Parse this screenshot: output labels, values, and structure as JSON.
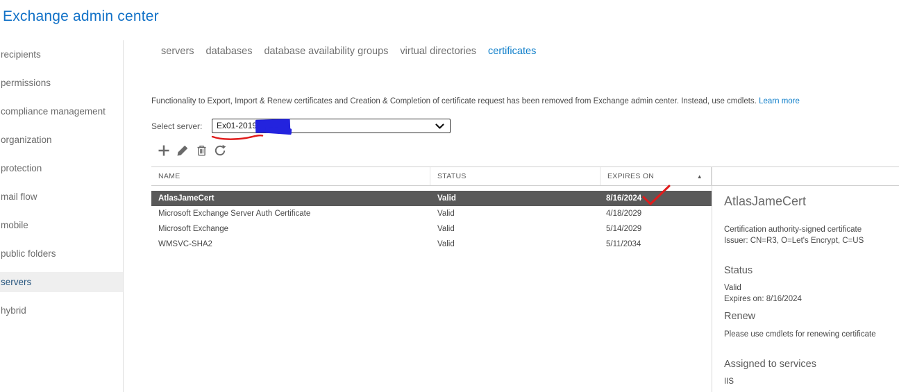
{
  "app": {
    "title": "Exchange admin center"
  },
  "sidebar": {
    "items": [
      {
        "label": "recipients",
        "selected": false
      },
      {
        "label": "permissions",
        "selected": false
      },
      {
        "label": "compliance management",
        "selected": false
      },
      {
        "label": "organization",
        "selected": false
      },
      {
        "label": "protection",
        "selected": false
      },
      {
        "label": "mail flow",
        "selected": false
      },
      {
        "label": "mobile",
        "selected": false
      },
      {
        "label": "public folders",
        "selected": false
      },
      {
        "label": "servers",
        "selected": true
      },
      {
        "label": "hybrid",
        "selected": false
      }
    ]
  },
  "tabs": [
    {
      "label": "servers",
      "selected": false
    },
    {
      "label": "databases",
      "selected": false
    },
    {
      "label": "database availability groups",
      "selected": false
    },
    {
      "label": "virtual directories",
      "selected": false
    },
    {
      "label": "certificates",
      "selected": true
    }
  ],
  "notice": {
    "text": "Functionality to Export, Import & Renew certificates and Creation & Completion of certificate request has been removed from Exchange admin center. Instead, use cmdlets.",
    "link": "Learn more"
  },
  "server_selector": {
    "label": "Select server:",
    "value": "Ex01-2019.",
    "value_redacted": true
  },
  "toolbar": {
    "icons": [
      "add",
      "edit",
      "delete",
      "refresh"
    ]
  },
  "table": {
    "columns": [
      "NAME",
      "STATUS",
      "EXPIRES ON"
    ],
    "sort": {
      "column": "EXPIRES ON",
      "direction": "asc",
      "glyph": "▲"
    },
    "rows": [
      {
        "name": "AtlasJameCert",
        "status": "Valid",
        "expires": "8/16/2024",
        "selected": true
      },
      {
        "name": "Microsoft Exchange Server Auth Certificate",
        "status": "Valid",
        "expires": "4/18/2029",
        "selected": false
      },
      {
        "name": "Microsoft Exchange",
        "status": "Valid",
        "expires": "5/14/2029",
        "selected": false
      },
      {
        "name": "WMSVC-SHA2",
        "status": "Valid",
        "expires": "5/11/2034",
        "selected": false
      }
    ]
  },
  "details": {
    "title": "AtlasJameCert",
    "type_line": "Certification authority-signed certificate",
    "issuer_line": "Issuer: CN=R3, O=Let's Encrypt, C=US",
    "status_heading": "Status",
    "status_value": "Valid",
    "expires_line": "Expires on: 8/16/2024",
    "renew_heading": "Renew",
    "renew_text": "Please use cmdlets for renewing certificate",
    "assigned_heading": "Assigned to services",
    "assigned_value": "IIS"
  },
  "annotations": {
    "red_underline": "hand-drawn red underline under server name",
    "red_checkmark": "hand-drawn red checkmark next to 8/16/2024",
    "blue_redaction": "blue scribble hiding part of server name"
  },
  "colors": {
    "title_blue": "#1171c7",
    "link_blue": "#0a7cc9",
    "selected_row_bg": "#595959",
    "sidebar_selected_text": "#26557e",
    "annotation_red": "#e01b1b",
    "redaction_blue": "#2323de"
  }
}
